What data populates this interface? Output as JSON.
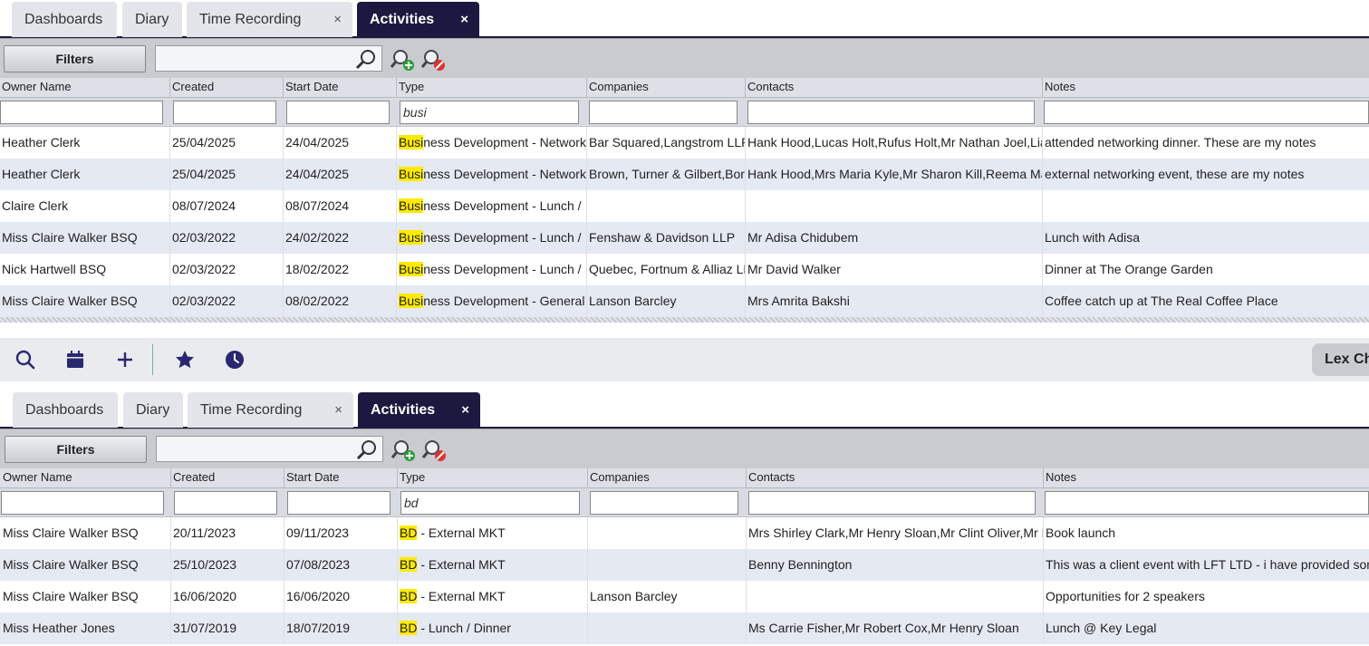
{
  "tabs": [
    {
      "label": "Dashboards",
      "closable": false,
      "active": false
    },
    {
      "label": "Diary",
      "closable": false,
      "active": false
    },
    {
      "label": "Time Recording",
      "closable": true,
      "active": false
    },
    {
      "label": "Activities",
      "closable": true,
      "active": true
    }
  ],
  "close_glyph": "×",
  "toolbar": {
    "filters_label": "Filters",
    "search_value": ""
  },
  "columns": [
    "Owner Name",
    "Created",
    "Start Date",
    "Type",
    "Companies",
    "Contacts",
    "Notes"
  ],
  "top_grid": {
    "type_filter": "busi",
    "rows": [
      {
        "owner": "Heather Clerk",
        "created": "25/04/2025",
        "start": "24/04/2025",
        "type_hl": "Busi",
        "type_rest": "ness Development - Network",
        "companies": "Bar Squared,Langstrom LLP",
        "contacts": "Hank Hood,Lucas Holt,Rufus Holt,Mr Nathan Joel,Lia",
        "notes": "attended networking dinner. These are my notes"
      },
      {
        "owner": "Heather Clerk",
        "created": "25/04/2025",
        "start": "24/04/2025",
        "type_hl": "Busi",
        "type_rest": "ness Development - Network",
        "companies": "Brown, Turner & Gilbert,Bor",
        "contacts": "Hank Hood,Mrs Maria Kyle,Mr Sharon Kill,Reema Ma",
        "notes": "external networking event, these are my notes"
      },
      {
        "owner": "Claire Clerk",
        "created": "08/07/2024",
        "start": "08/07/2024",
        "type_hl": "Busi",
        "type_rest": "ness Development - Lunch /",
        "companies": "",
        "contacts": "",
        "notes": ""
      },
      {
        "owner": "Miss Claire Walker BSQ",
        "created": "02/03/2022",
        "start": "24/02/2022",
        "type_hl": "Busi",
        "type_rest": "ness Development - Lunch /",
        "companies": "Fenshaw & Davidson LLP",
        "contacts": "Mr Adisa Chidubem",
        "notes": "Lunch with Adisa"
      },
      {
        "owner": "Nick Hartwell BSQ",
        "created": "02/03/2022",
        "start": "18/02/2022",
        "type_hl": "Busi",
        "type_rest": "ness Development - Lunch /",
        "companies": "Quebec, Fortnum & Alliaz LL",
        "contacts": "Mr David Walker",
        "notes": "Dinner at The Orange Garden"
      },
      {
        "owner": "Miss Claire Walker BSQ",
        "created": "02/03/2022",
        "start": "08/02/2022",
        "type_hl": "Busi",
        "type_rest": "ness Development - General",
        "companies": "Lanson Barcley",
        "contacts": "Mrs Amrita Bakshi",
        "notes": "Coffee catch up at The Real Coffee Place"
      }
    ]
  },
  "appbar": {
    "user_label": "Lex Ch"
  },
  "bottom_grid": {
    "type_filter": "bd",
    "rows": [
      {
        "owner": "Miss Claire Walker BSQ",
        "created": "20/11/2023",
        "start": "09/11/2023",
        "type_hl": "BD",
        "type_rest": " - External MKT",
        "companies": "",
        "contacts": "Mrs Shirley Clark,Mr Henry Sloan,Mr Clint Oliver,Mr M",
        "notes": "Book launch"
      },
      {
        "owner": "Miss Claire Walker BSQ",
        "created": "25/10/2023",
        "start": "07/08/2023",
        "type_hl": "BD",
        "type_rest": " - External MKT",
        "companies": "",
        "contacts": "Benny Bennington",
        "notes": "This was a client event with LFT LTD - i have provided som"
      },
      {
        "owner": "Miss Claire Walker BSQ",
        "created": "16/06/2020",
        "start": "16/06/2020",
        "type_hl": "BD",
        "type_rest": " - External MKT",
        "companies": "Lanson Barcley",
        "contacts": "",
        "notes": "Opportunities for 2 speakers"
      },
      {
        "owner": "Miss Heather Jones",
        "created": "31/07/2019",
        "start": "18/07/2019",
        "type_hl": "BD",
        "type_rest": " - Lunch / Dinner",
        "companies": "",
        "contacts": "Ms Carrie Fisher,Mr Robert Cox,Mr Henry Sloan",
        "notes": "Lunch @ Key Legal"
      }
    ]
  },
  "colors": {
    "active_tab": "#1b1940",
    "highlight": "#ffea00",
    "app_icon": "#2a2870",
    "alt_row": "#e5e9f2"
  }
}
